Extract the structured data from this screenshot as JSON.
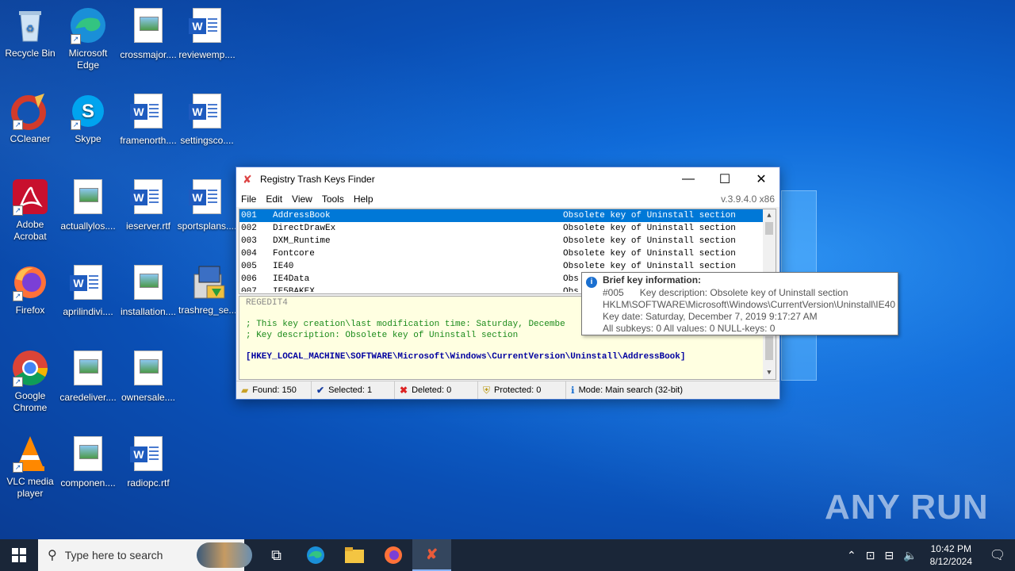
{
  "desktop": {
    "icons": [
      {
        "label": "Recycle Bin"
      },
      {
        "label": "Microsoft Edge"
      },
      {
        "label": "crossmajor...."
      },
      {
        "label": "reviewemp...."
      },
      {
        "label": "CCleaner"
      },
      {
        "label": "Skype"
      },
      {
        "label": "framenorth...."
      },
      {
        "label": "settingsco...."
      },
      {
        "label": "Adobe Acrobat"
      },
      {
        "label": "actuallylos...."
      },
      {
        "label": "ieserver.rtf"
      },
      {
        "label": "sportsplans...."
      },
      {
        "label": "Firefox"
      },
      {
        "label": "aprilindivi...."
      },
      {
        "label": "installation...."
      },
      {
        "label": "trashreg_se...."
      },
      {
        "label": "Google Chrome"
      },
      {
        "label": "caredeliver...."
      },
      {
        "label": "ownersale...."
      },
      {
        "label": "VLC media player"
      },
      {
        "label": "componen...."
      },
      {
        "label": "radiopc.rtf"
      }
    ]
  },
  "window": {
    "title": "Registry Trash Keys Finder",
    "version": "v.3.9.4.0 x86",
    "menu": [
      "File",
      "Edit",
      "View",
      "Tools",
      "Help"
    ],
    "rows": [
      {
        "num": "001",
        "name": "AddressBook",
        "desc": "Obsolete key of Uninstall section"
      },
      {
        "num": "002",
        "name": "DirectDrawEx",
        "desc": "Obsolete key of Uninstall section"
      },
      {
        "num": "003",
        "name": "DXM_Runtime",
        "desc": "Obsolete key of Uninstall section"
      },
      {
        "num": "004",
        "name": "Fontcore",
        "desc": "Obsolete key of Uninstall section"
      },
      {
        "num": "005",
        "name": "IE40",
        "desc": "Obsolete key of Uninstall section"
      },
      {
        "num": "006",
        "name": "IE4Data",
        "desc": "Obs"
      },
      {
        "num": "007",
        "name": "IE5BAKEX",
        "desc": "Obs"
      }
    ],
    "text": {
      "header": "REGEDIT4",
      "comment1": "; This key creation\\last modification time: Saturday, Decembe",
      "comment2": "; Key description: Obsolete key of Uninstall section",
      "key": "[HKEY_LOCAL_MACHINE\\SOFTWARE\\Microsoft\\Windows\\CurrentVersion\\Uninstall\\AddressBook]"
    },
    "status": {
      "found": "Found: 150",
      "selected": "Selected: 1",
      "deleted": "Deleted: 0",
      "protected": "Protected: 0",
      "mode": "Mode: Main search (32-bit)"
    }
  },
  "tooltip": {
    "title": "Brief key information:",
    "line1_num": "#005",
    "line1_desc": "Key description:  Obsolete key of Uninstall section",
    "line2": "HKLM\\SOFTWARE\\Microsoft\\Windows\\CurrentVersion\\Uninstall\\IE40",
    "line3": "Key date: Saturday, December 7, 2019 9:17:27 AM",
    "line4": "All subkeys: 0    All values: 0    NULL-keys: 0"
  },
  "watermark": "ANY RUN",
  "taskbar": {
    "search_placeholder": "Type here to search",
    "time": "10:42 PM",
    "date": "8/12/2024"
  }
}
